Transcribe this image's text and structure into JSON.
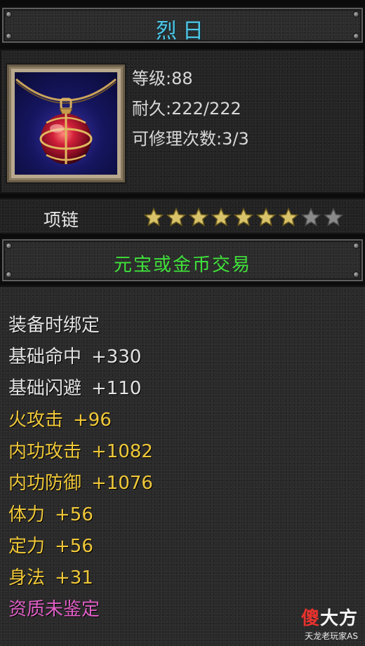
{
  "title": "烈日",
  "item_icon": "red-orb-necklace-icon",
  "info": {
    "level": "等级:88",
    "durability": "耐久:222/222",
    "repair": "可修理次数:3/3"
  },
  "item_type": "项链",
  "stars": {
    "total": 9,
    "filled": 7
  },
  "trade": "元宝或金币交易",
  "attributes": [
    {
      "name": "装备时绑定",
      "value": "",
      "color": "white"
    },
    {
      "name": "基础命中",
      "value": "+330",
      "color": "white"
    },
    {
      "name": "基础闪避",
      "value": "+110",
      "color": "white"
    },
    {
      "name": "火攻击",
      "value": "+96",
      "color": "yellow"
    },
    {
      "name": "内功攻击",
      "value": "+1082",
      "color": "yellow"
    },
    {
      "name": "内功防御",
      "value": "+1076",
      "color": "yellow"
    },
    {
      "name": "体力",
      "value": "+56",
      "color": "yellow"
    },
    {
      "name": "定力",
      "value": "+56",
      "color": "yellow"
    },
    {
      "name": "身法",
      "value": "+31",
      "color": "yellow"
    },
    {
      "name": "资质未鉴定",
      "value": "",
      "color": "pink"
    }
  ],
  "watermark": {
    "logo_a": "傻",
    "logo_b": "大方",
    "sub": "天龙老玩家AS"
  },
  "colors": {
    "title": "#4fc8e8",
    "trade": "#3fe23a",
    "star_filled": "#d8c36a",
    "star_empty": "#8a8a8a",
    "attr_white": "#e4e4e4",
    "attr_yellow": "#f0c83a",
    "attr_pink": "#e05fc6"
  }
}
